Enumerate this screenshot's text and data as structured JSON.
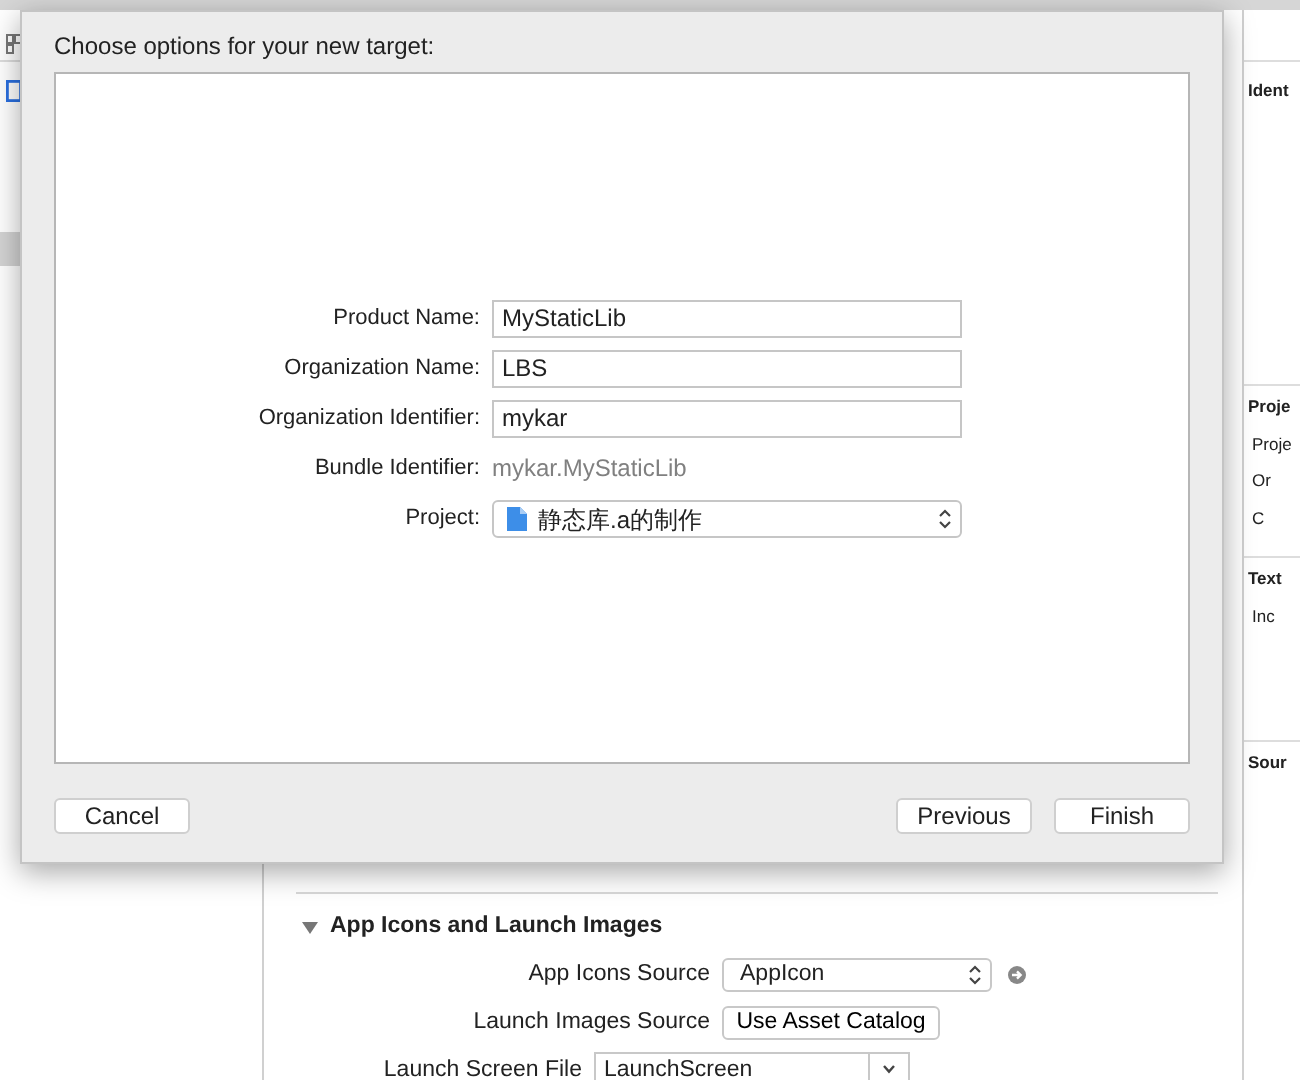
{
  "dialog": {
    "title": "Choose options for your new target:",
    "fields": [
      {
        "label": "Product Name:",
        "kind": "text",
        "value": "MyStaticLib"
      },
      {
        "label": "Organization Name:",
        "kind": "text",
        "value": "LBS"
      },
      {
        "label": "Organization Identifier:",
        "kind": "text",
        "value": "mykar"
      },
      {
        "label": "Bundle Identifier:",
        "kind": "static",
        "value": "mykar.MyStaticLib"
      },
      {
        "label": "Project:",
        "kind": "popup",
        "value": "静态库.a的制作"
      }
    ],
    "buttons": [
      {
        "label": "Cancel"
      },
      {
        "label": "Previous"
      },
      {
        "label": "Finish"
      }
    ]
  },
  "editor": {
    "section": {
      "title": "App Icons and Launch Images",
      "expanded": true,
      "rows": [
        {
          "label": "App Icons Source",
          "kind": "popup",
          "value": "AppIcon"
        },
        {
          "label": "Launch Images Source",
          "kind": "button",
          "value": "Use Asset Catalog"
        },
        {
          "label": "Launch Screen File",
          "kind": "combo",
          "value": "LaunchScreen"
        }
      ]
    }
  },
  "inspector": {
    "items": [
      {
        "kind": "heading",
        "text": "Ident"
      },
      {
        "kind": "heading",
        "text": "Proje"
      },
      {
        "kind": "field",
        "text": "Proje"
      },
      {
        "kind": "field",
        "text": "Or"
      },
      {
        "kind": "field",
        "text": "C"
      },
      {
        "kind": "heading",
        "text": "Text"
      },
      {
        "kind": "field",
        "text": "Inc"
      },
      {
        "kind": "heading",
        "text": "Sour"
      }
    ]
  }
}
